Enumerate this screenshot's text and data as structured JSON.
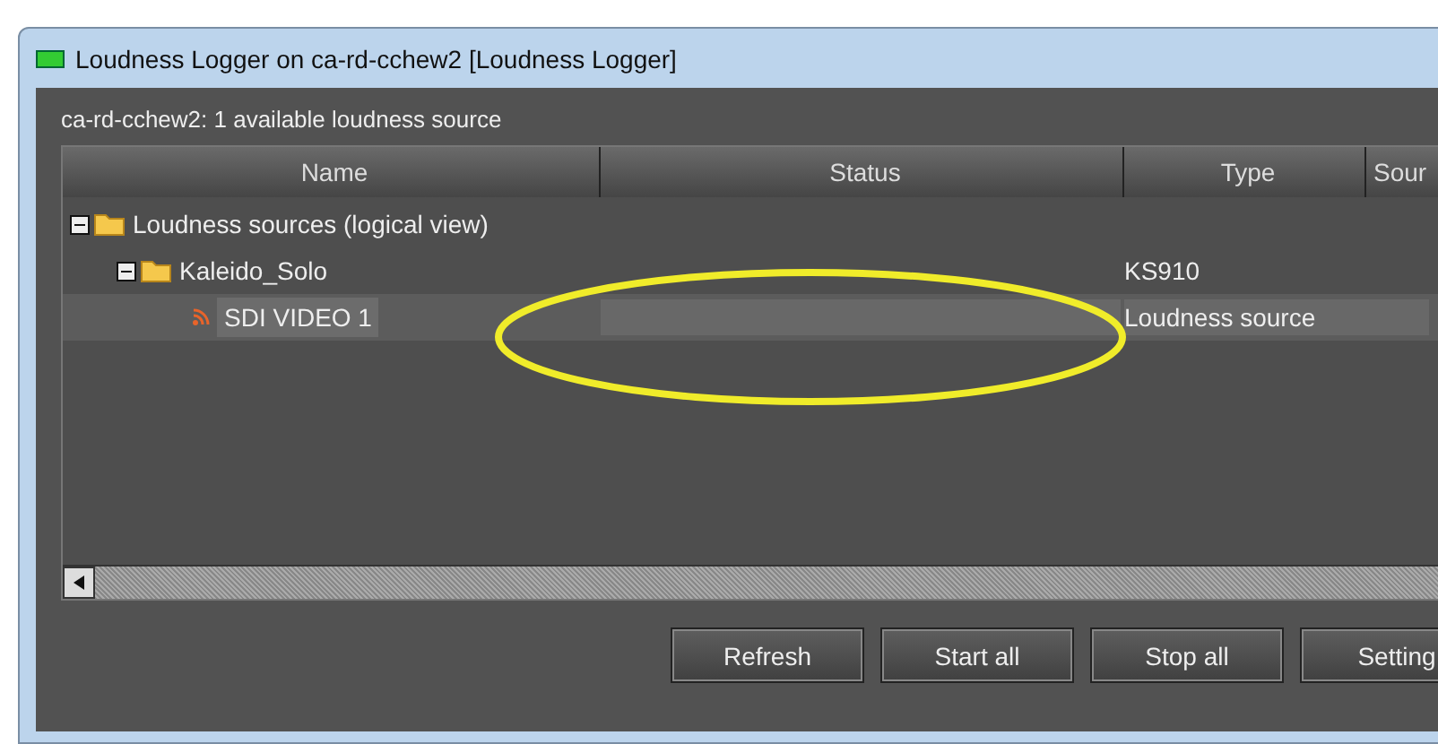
{
  "window": {
    "title": "Loudness Logger on ca-rd-cchew2 [Loudness Logger]"
  },
  "summary": "ca-rd-cchew2: 1 available loudness source",
  "table": {
    "columns": [
      "Name",
      "Status",
      "Type",
      "Sour"
    ],
    "rows": [
      {
        "name": "Loudness sources (logical view)",
        "kind": "folder",
        "expanded": true,
        "selected": false,
        "children": [
          {
            "name": "Kaleido_Solo",
            "kind": "folder",
            "expanded": true,
            "selected": false,
            "type": "KS910",
            "children": [
              {
                "name": "SDI VIDEO 1",
                "kind": "source",
                "selected": true,
                "type": "Loudness source"
              }
            ]
          }
        ]
      }
    ]
  },
  "buttons": [
    "Refresh",
    "Start all",
    "Stop all",
    "Setting"
  ]
}
